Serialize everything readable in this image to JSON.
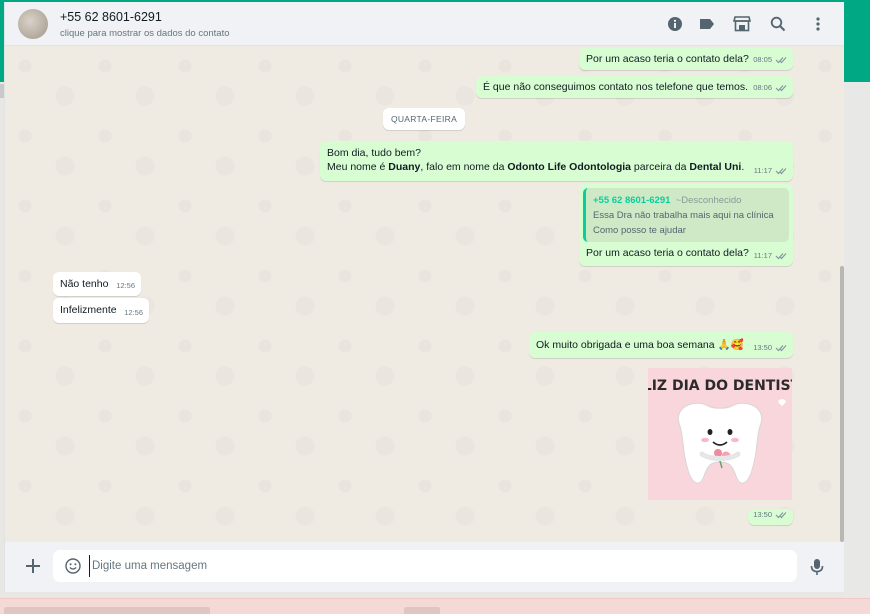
{
  "header": {
    "contact_name": "+55 62 8601-6291",
    "contact_subtitle": "clique para mostrar os dados do contato",
    "icons": [
      "info-icon",
      "label-icon",
      "store-icon",
      "search-icon",
      "menu-icon"
    ]
  },
  "day_divider": "QUARTA-FEIRA",
  "messages": {
    "m1": {
      "text": "Por um acaso teria o contato dela?",
      "time": "08:05"
    },
    "m2": {
      "text": "É que não conseguimos contato nos telefone que temos.",
      "time": "08:06"
    },
    "m3": {
      "line1": "Bom dia, tudo bem?",
      "line2_a": "Meu nome é ",
      "line2_b": "Duany",
      "line2_c": ", falo em nome da ",
      "line2_d": "Odonto Life Odontologia",
      "line2_e": " parceira da ",
      "line2_f": "Dental Uni",
      "line2_g": ".",
      "time": "11:17"
    },
    "m4": {
      "quote_name": "+55 62 8601-6291",
      "quote_status": "~Desconhecido",
      "quote_line1": "Essa Dra não trabalha mais aqui na clínica",
      "quote_line2": "Como posso te ajudar",
      "text": "Por um acaso teria o contato dela?",
      "time": "11:17"
    },
    "m5": {
      "text": "Não tenho",
      "time": "12:56"
    },
    "m6": {
      "text": "Infelizmente",
      "time": "12:56"
    },
    "m7": {
      "text": "Ok muito obrigada e uma boa semana 🙏🥰",
      "time": "13:50"
    },
    "m8": {
      "sticker_text": "FELIZ DIA DO DENTISTA!",
      "time": "13:50"
    }
  },
  "composer": {
    "placeholder": "Digite uma mensagem",
    "value": ""
  },
  "colors": {
    "outgoing_bubble": "#d9fdd3",
    "incoming_bubble": "#ffffff",
    "accent": "#00a884",
    "chat_bg": "#efeae2"
  }
}
